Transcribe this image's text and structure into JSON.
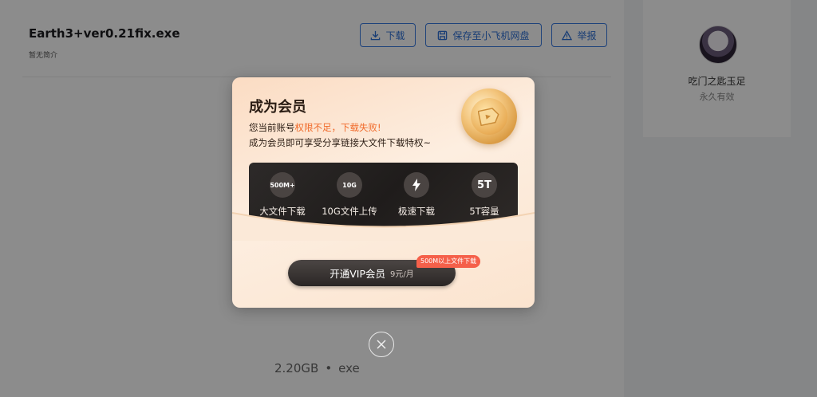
{
  "file": {
    "name": "Earth3+ver0.21fix.exe",
    "description": "暂无简介",
    "size": "2.20GB",
    "dot": "•",
    "type": "exe"
  },
  "toolbar": {
    "download_label": "下载",
    "save_label": "保存至小飞机网盘",
    "report_label": "举报"
  },
  "user": {
    "name": "吃门之匙玉足",
    "status": "永久有效"
  },
  "modal": {
    "title": "成为会员",
    "line1_prefix": "您当前账号",
    "line1_warning": "权限不足，下载失败!",
    "line2": "成为会员即可享受分享链接大文件下载特权~",
    "perks": [
      {
        "icon_text": "500M+",
        "label": "大文件下载"
      },
      {
        "icon_text": "10G",
        "label": "10G文件上传"
      },
      {
        "icon": "lightning-icon",
        "label": "极速下载"
      },
      {
        "icon_text": "5T",
        "label": "5T容量"
      }
    ],
    "vip_button_label": "开通VIP会员",
    "vip_button_price": "9元/月",
    "vip_badge": "500M以上文件下载"
  },
  "colors": {
    "accent_blue": "#2d6fd6",
    "warning_orange": "#f06a2a",
    "badge_red": "#f5604a"
  }
}
